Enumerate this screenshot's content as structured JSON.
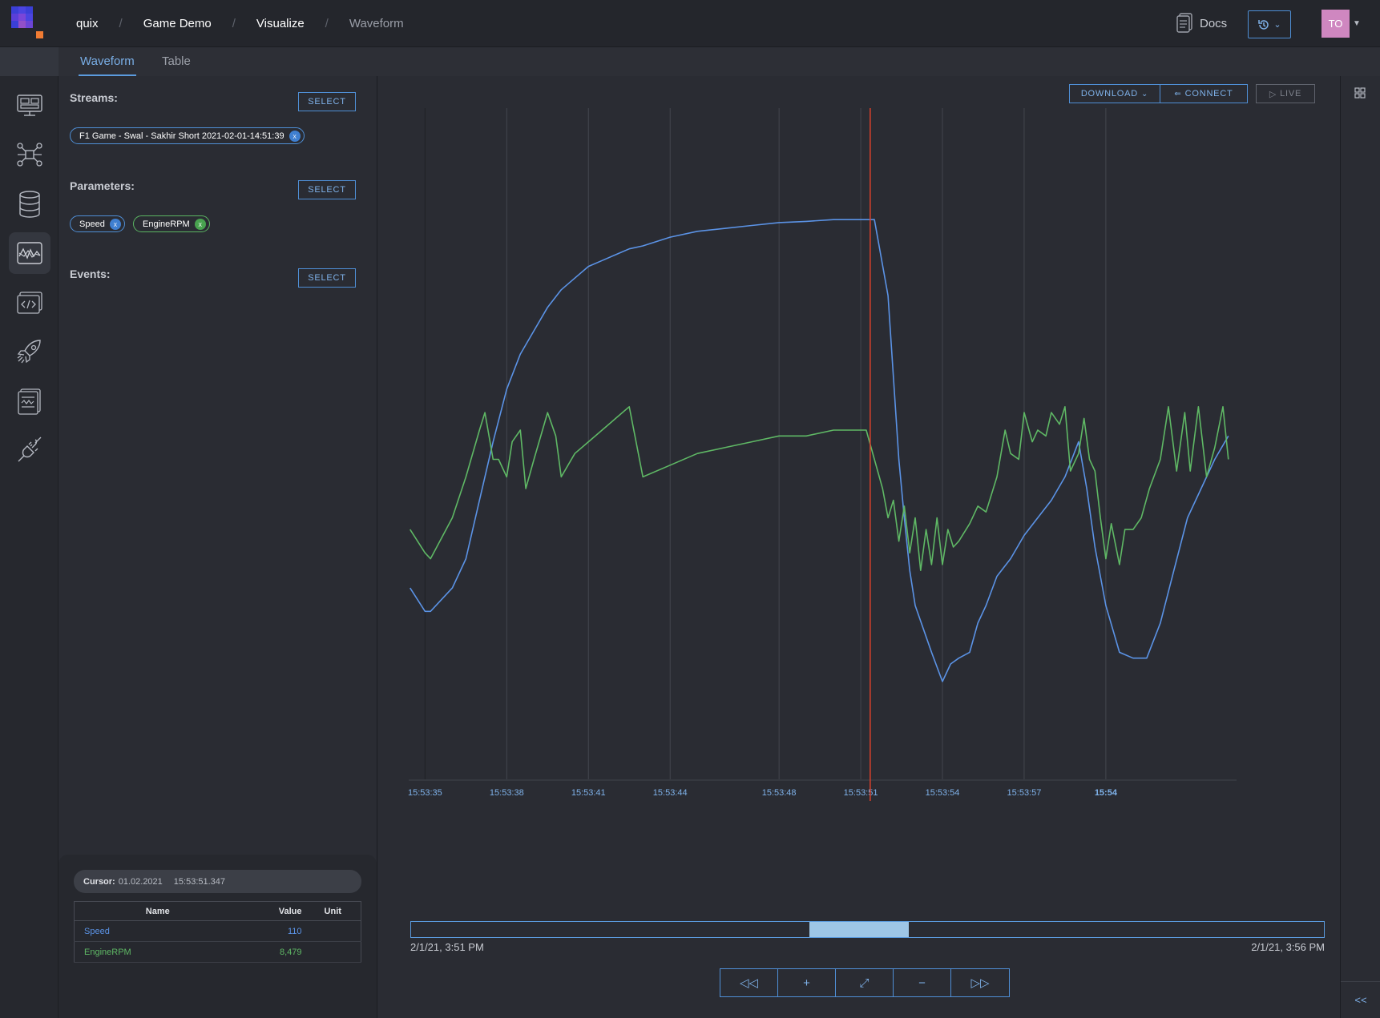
{
  "header": {
    "breadcrumbs": [
      {
        "label": "quix"
      },
      {
        "label": "Game Demo"
      },
      {
        "label": "Visualize"
      },
      {
        "label": "Waveform"
      }
    ],
    "docs_label": "Docs",
    "avatar_initials": "TO"
  },
  "nav": {
    "icons": [
      "dashboard-icon",
      "topology-icon",
      "database-icon",
      "waveform-icon",
      "code-icon",
      "deploy-rocket-icon",
      "monitor-icon",
      "connector-icon"
    ],
    "active": "waveform-icon"
  },
  "tabs": [
    {
      "label": "Waveform",
      "active": true
    },
    {
      "label": "Table",
      "active": false
    }
  ],
  "panel": {
    "streams": {
      "title": "Streams:",
      "select_label": "SELECT",
      "chips": [
        {
          "label": "F1 Game - Swal - Sakhir Short 2021-02-01-14:51:39",
          "x": "x"
        }
      ]
    },
    "parameters": {
      "title": "Parameters:",
      "select_label": "SELECT",
      "chips": [
        {
          "label": "Speed",
          "x": "x"
        },
        {
          "label": "EngineRPM",
          "x": "x"
        }
      ]
    },
    "events": {
      "title": "Events:",
      "select_label": "SELECT"
    },
    "cursor": {
      "label": "Cursor:",
      "date": "01.02.2021",
      "time": "15:53:51.347",
      "columns": [
        "Name",
        "Value",
        "Unit"
      ],
      "rows": [
        {
          "name": "Speed",
          "value": "110",
          "unit": ""
        },
        {
          "name": "EngineRPM",
          "value": "8,479",
          "unit": ""
        }
      ]
    }
  },
  "toolbar": {
    "download_label": "DOWNLOAD",
    "connect_label": "CONNECT",
    "live_label": "LIVE"
  },
  "range": {
    "start_label": "2/1/21, 3:51 PM",
    "end_label": "2/1/21, 3:56 PM",
    "selection_start_fraction": 0.436,
    "selection_end_fraction": 0.545
  },
  "controls": [
    "rewind-icon",
    "zoom-in-icon",
    "fit-icon",
    "zoom-out-icon",
    "fast-forward-icon"
  ],
  "colors": {
    "speed": "#5b93e6",
    "engine_rpm": "#5fb865",
    "cursor_line": "#d9402b",
    "accent": "#5b9bde"
  },
  "chart_data": {
    "type": "line",
    "x_ticks": [
      "15:53:35",
      "15:53:38",
      "15:53:41",
      "15:53:44",
      "15:53:48",
      "15:53:51",
      "15:53:54",
      "15:53:57",
      "15:54"
    ],
    "x_range_seconds_from_15_53_35": [
      -0.6,
      29.8
    ],
    "cursor_time": "15:53:51.347",
    "y_range": [
      0,
      1
    ],
    "series": [
      {
        "name": "Speed",
        "color": "#5b93e6",
        "t": [
          -0.55,
          0,
          0.2,
          1,
          1.5,
          2,
          2.5,
          3,
          3.5,
          4,
          4.5,
          5,
          5.5,
          6,
          6.5,
          7,
          7.5,
          8,
          9,
          10,
          11,
          12,
          13,
          14,
          15,
          16,
          16.5,
          17,
          17.4,
          17.6,
          17.8,
          18,
          18.3,
          18.6,
          19,
          19.3,
          19.6,
          20,
          20.3,
          20.6,
          21,
          21.5,
          22,
          22.5,
          23,
          23.5,
          24,
          24.3,
          24.6,
          25,
          25.5,
          26,
          26.5,
          27,
          27.5,
          28,
          28.5,
          29,
          29.5
        ],
        "y": [
          0.33,
          0.29,
          0.29,
          0.33,
          0.38,
          0.48,
          0.58,
          0.67,
          0.73,
          0.77,
          0.81,
          0.84,
          0.86,
          0.88,
          0.89,
          0.9,
          0.91,
          0.915,
          0.93,
          0.94,
          0.945,
          0.95,
          0.955,
          0.957,
          0.96,
          0.96,
          0.96,
          0.83,
          0.55,
          0.45,
          0.36,
          0.3,
          0.26,
          0.22,
          0.17,
          0.2,
          0.21,
          0.22,
          0.27,
          0.3,
          0.35,
          0.38,
          0.42,
          0.45,
          0.48,
          0.52,
          0.58,
          0.5,
          0.4,
          0.3,
          0.22,
          0.21,
          0.21,
          0.27,
          0.36,
          0.45,
          0.5,
          0.55,
          0.59
        ]
      },
      {
        "name": "EngineRPM",
        "color": "#5fb865",
        "t": [
          -0.55,
          0,
          0.2,
          1,
          1.5,
          2,
          2.2,
          2.5,
          2.7,
          3,
          3.2,
          3.5,
          3.7,
          4,
          4.5,
          4.8,
          5,
          5.5,
          6,
          6.5,
          7,
          7.5,
          8,
          9,
          10,
          11,
          12,
          13,
          14,
          15,
          16,
          16.2,
          16.5,
          16.8,
          17,
          17.2,
          17.4,
          17.6,
          17.8,
          18,
          18.2,
          18.4,
          18.6,
          18.8,
          19,
          19.2,
          19.4,
          19.6,
          20,
          20.3,
          20.6,
          21,
          21.3,
          21.5,
          21.8,
          22,
          22.3,
          22.5,
          22.8,
          23,
          23.3,
          23.5,
          23.7,
          24,
          24.2,
          24.4,
          24.6,
          24.8,
          25,
          25.2,
          25.5,
          25.7,
          26,
          26.3,
          26.6,
          27,
          27.3,
          27.6,
          27.9,
          28.1,
          28.4,
          28.7,
          29,
          29.3,
          29.5
        ],
        "y": [
          0.43,
          0.39,
          0.38,
          0.45,
          0.52,
          0.6,
          0.63,
          0.55,
          0.55,
          0.52,
          0.58,
          0.6,
          0.5,
          0.55,
          0.63,
          0.59,
          0.52,
          0.56,
          0.58,
          0.6,
          0.62,
          0.64,
          0.52,
          0.54,
          0.56,
          0.57,
          0.58,
          0.59,
          0.59,
          0.6,
          0.6,
          0.6,
          0.55,
          0.5,
          0.45,
          0.48,
          0.41,
          0.47,
          0.39,
          0.45,
          0.36,
          0.43,
          0.37,
          0.45,
          0.37,
          0.43,
          0.4,
          0.41,
          0.44,
          0.47,
          0.46,
          0.52,
          0.6,
          0.56,
          0.55,
          0.63,
          0.58,
          0.6,
          0.59,
          0.63,
          0.61,
          0.64,
          0.53,
          0.56,
          0.62,
          0.55,
          0.53,
          0.45,
          0.38,
          0.44,
          0.37,
          0.43,
          0.43,
          0.45,
          0.5,
          0.55,
          0.64,
          0.53,
          0.63,
          0.53,
          0.64,
          0.52,
          0.57,
          0.64,
          0.55
        ]
      }
    ]
  }
}
